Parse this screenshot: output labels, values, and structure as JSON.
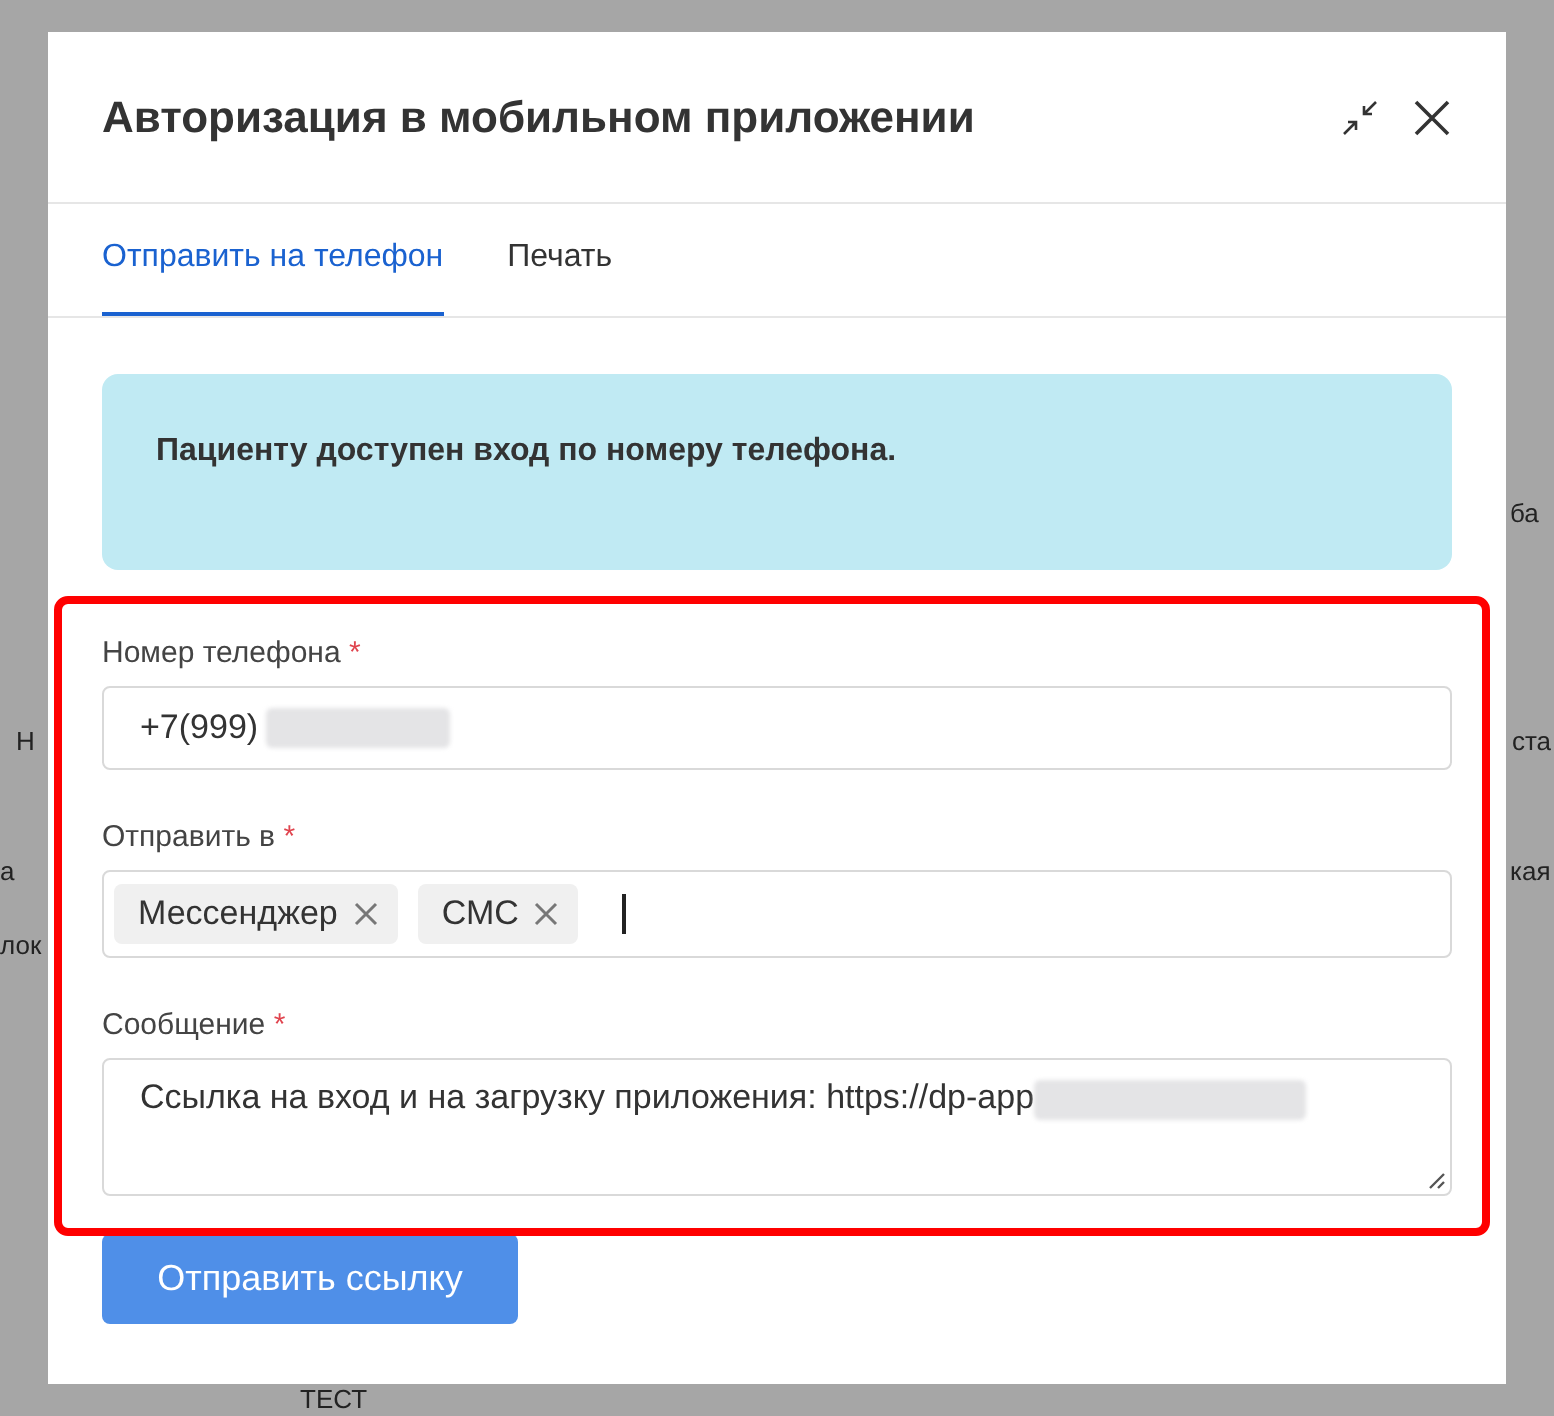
{
  "background_fragments": [
    {
      "text": "ба"
    },
    {
      "text": "Н"
    },
    {
      "text": "ста"
    },
    {
      "text": "а"
    },
    {
      "text": "кая"
    },
    {
      "text": "лок"
    },
    {
      "text": "ТЕСТ"
    }
  ],
  "dialog": {
    "title": "Авторизация в мобильном приложении",
    "tabs": [
      {
        "label": "Отправить на телефон",
        "selected": true
      },
      {
        "label": "Печать",
        "selected": false
      }
    ],
    "alert": {
      "text": "Пациенту доступен вход по номеру телефона."
    },
    "fields": [
      {
        "kind": "text",
        "label": "Номер телефона",
        "required_mark": "*",
        "value": "+7(999)"
      },
      {
        "kind": "tags",
        "label": "Отправить в",
        "required_mark": "*",
        "tags": [
          "Мессенджер",
          "СМС"
        ]
      },
      {
        "kind": "textarea",
        "label": "Сообщение",
        "required_mark": "*",
        "value": "Ссылка на вход и на загрузку приложения: https://dp-app"
      }
    ],
    "submit_button": "Отправить ссылку"
  }
}
